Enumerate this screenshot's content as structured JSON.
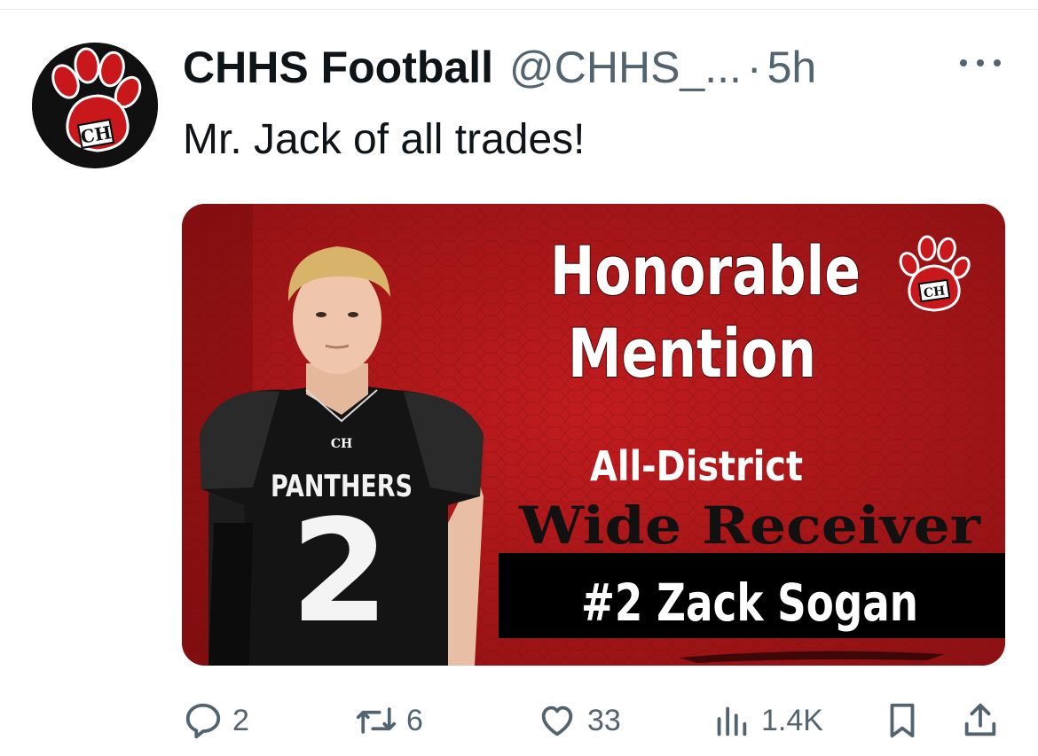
{
  "tweet": {
    "author_name": "CHHS Football",
    "handle": "@CHHS_...",
    "separator": "·",
    "time": "5h",
    "text": "Mr. Jack of all trades!"
  },
  "avatar": {
    "monogram": "CH"
  },
  "media": {
    "headline_line1": "Honorable",
    "headline_line2": "Mention",
    "subtitle": "All-District",
    "position": "Wide Receiver",
    "player": "#2 Zack Sogan",
    "jersey_text": "PANTHERS",
    "jersey_number": "2",
    "jersey_logo": "CH",
    "logo_monogram": "CH"
  },
  "actions": {
    "replies": "2",
    "retweets": "6",
    "likes": "33",
    "views": "1.4K"
  },
  "icons": [
    "more-icon",
    "reply-icon",
    "retweet-icon",
    "like-icon",
    "views-icon",
    "bookmark-icon",
    "share-icon",
    "paw-icon"
  ],
  "colors": {
    "accent_red": "#c8181b",
    "text": "#0f1419",
    "secondary": "#536471"
  }
}
